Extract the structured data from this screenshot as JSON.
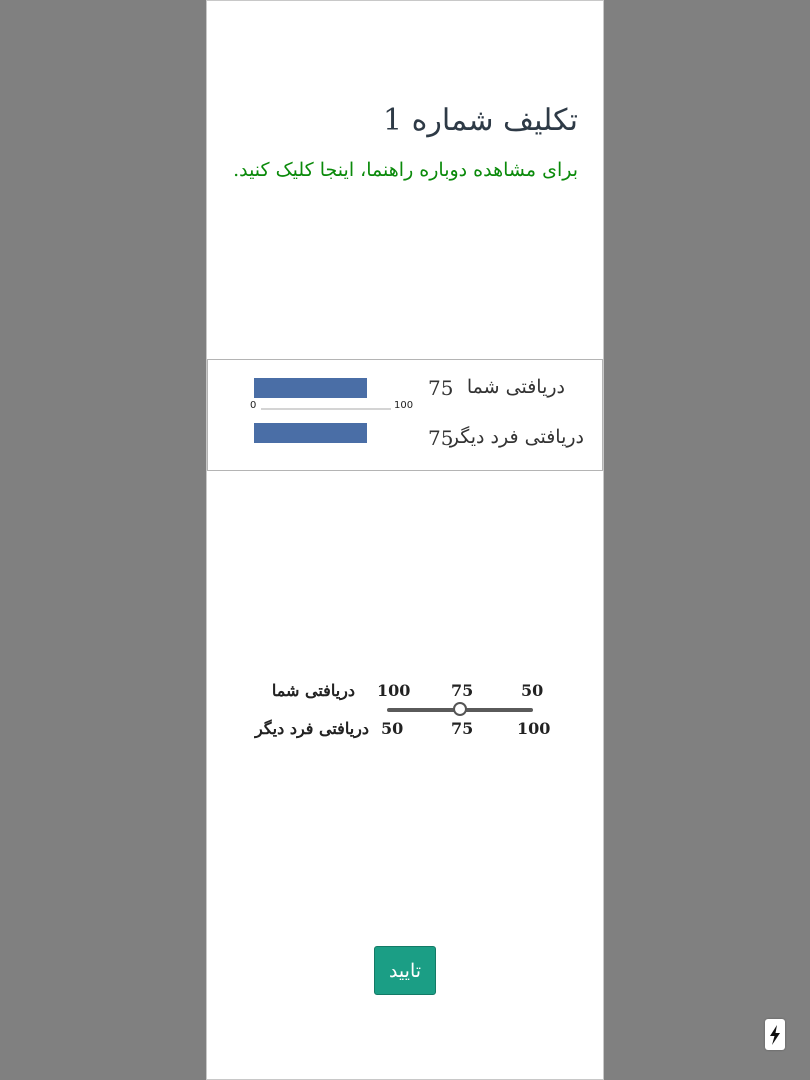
{
  "task": {
    "title": "تکلیف شماره 1",
    "help_link": "برای مشاهده دوباره راهنما، اینجا کلیک کنید."
  },
  "payoff": {
    "you_label": "دریافتی شما",
    "you_value": "75",
    "other_label": "دریافتی فرد دیگر",
    "other_value": "75",
    "axis_min": "0",
    "axis_max": "100",
    "you_fraction": 0.75,
    "other_fraction": 0.75,
    "bar_color": "#4a6ea6"
  },
  "slider": {
    "you_label": "دریافتی شما",
    "other_label": "دریافتی فرد دیگر",
    "you_ticks": [
      "100",
      "75",
      "50"
    ],
    "other_ticks": [
      "50",
      "75",
      "100"
    ],
    "position_fraction": 0.5
  },
  "confirm_label": "تایید",
  "fab_icon": "lightning-bolt-icon",
  "colors": {
    "accent": "#1b9e85",
    "link": "#0a8a0a",
    "background": "#808080"
  }
}
